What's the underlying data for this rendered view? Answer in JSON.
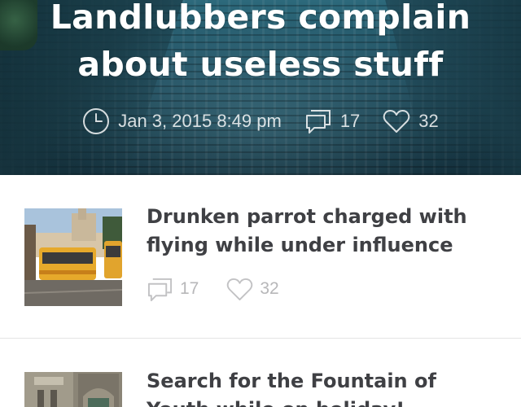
{
  "hero": {
    "title": "Landlubbers complain about useless stuff",
    "date": "Jan 3, 2015 8:49 pm",
    "comments": "17",
    "likes": "32",
    "meta_color": "#ffffff",
    "icons": {
      "time": "clock-icon",
      "comments": "comment-icon",
      "likes": "heart-icon"
    }
  },
  "articles": [
    {
      "headline": "Drunken parrot charged with flying while under influence",
      "comments": "17",
      "likes": "32",
      "thumbnail": "tram-photo"
    },
    {
      "headline": "Search for the Fountain of Youth while on holiday!",
      "thumbnail": "building-photo"
    }
  ],
  "colors": {
    "headline": "#3f4044",
    "stats": "#b7b7b9",
    "divider": "#e4e4e4",
    "hero_overlay": "#1d4656"
  }
}
